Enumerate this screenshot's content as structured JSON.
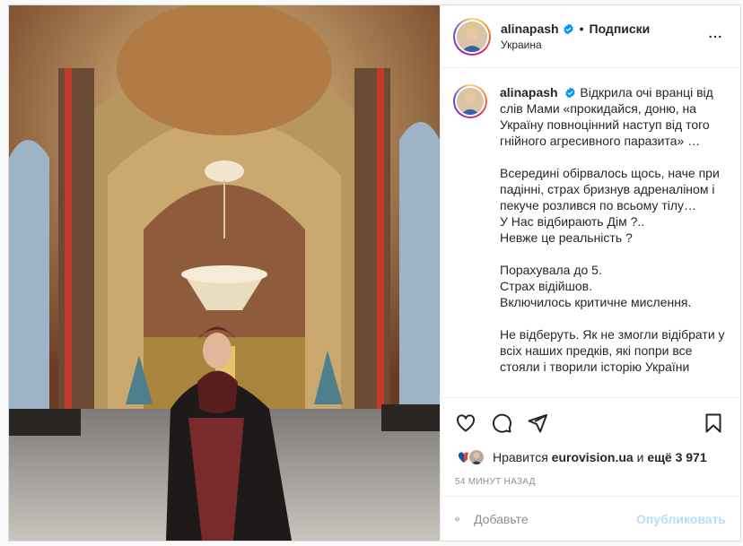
{
  "post": {
    "username": "alinapash",
    "follow_label": "Подписки",
    "separator": "•",
    "location": "Украина",
    "caption": {
      "username": "alinapash",
      "paragraphs": [
        [
          "Відкрила очі вранці від слів Мами «прокидайся, доню, на Україну повноцінний наступ від того гнійного агресивного паразита» …"
        ],
        [
          "Всередині обірвалось щось, наче при падінні, страх бризнув адреналіном і пекуче розлився по всьому тілу…",
          "У Нас відбирають Дім ?..",
          "Невже це реальність ?"
        ],
        [
          "Порахувала до 5.",
          "Страх відійшов.",
          "Включилось критичне мислення."
        ],
        [
          "Не відберуть. Як не змогли відібрати у всіх наших предків, які попри все стояли і творили історію України"
        ]
      ]
    },
    "likes": {
      "prefix": "Нравится",
      "liker": "eurovision.ua",
      "middle": "и",
      "rest": "ещё 3 971"
    },
    "timestamp": "54 МИНУТ НАЗАД",
    "comment": {
      "placeholder": "Добавьте",
      "publish_label": "Опубликовать"
    },
    "icons": [
      "verified-icon",
      "more-options-icon",
      "heart-icon",
      "comment-icon",
      "share-icon",
      "bookmark-icon",
      "emoji-icon"
    ],
    "colors": {
      "verified": "#0095f6",
      "publish_disabled": "#b2dffc",
      "muted": "#8e8e8e"
    }
  }
}
